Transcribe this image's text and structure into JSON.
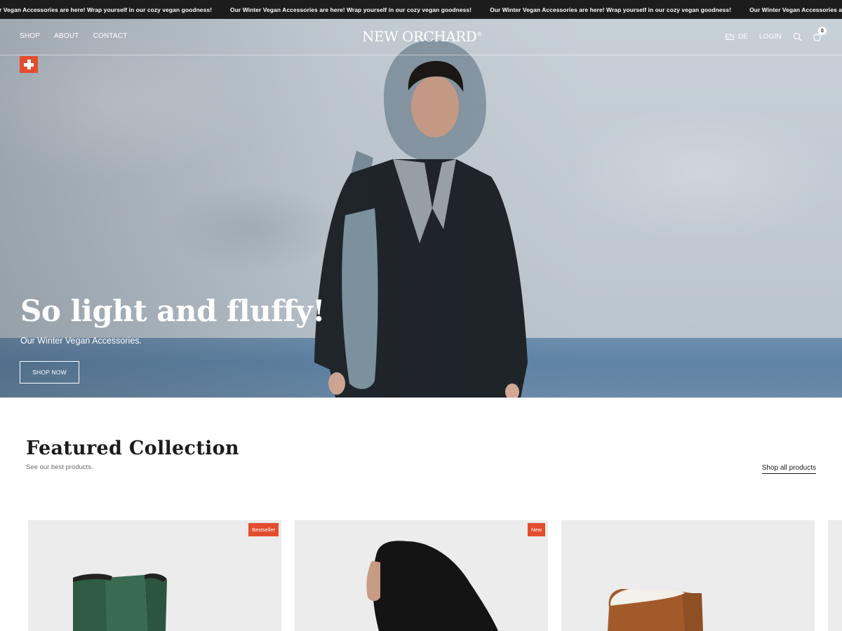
{
  "announcement": {
    "messages": [
      "Our Winter Vegan Accessories are here! Wrap yourself in our cozy vegan goodness!",
      "Our Winter Vegan Accessories are here! Wrap yourself in our cozy vegan goodness!",
      "Our Winter Vegan Accessories are here! Wrap yourself in our cozy vegan goodness!",
      "Our Winter Vegan Accessories are here! Wrap yourself in our cozy vegan goodness!"
    ]
  },
  "nav": {
    "left": [
      "SHOP",
      "ABOUT",
      "CONTACT"
    ],
    "logo": "NEW ORCHARD",
    "logo_mark": "®",
    "languages": [
      "EN",
      "DE"
    ],
    "active_language": "EN",
    "login": "LOGIN",
    "cart_count": "0",
    "icons": [
      "swiss-cross-icon",
      "search-icon",
      "cart-icon"
    ]
  },
  "hero": {
    "title": "So light and fluffy!",
    "subtitle": "Our Winter Vegan Accessories.",
    "cta": "SHOP NOW"
  },
  "featured": {
    "title": "Featured Collection",
    "subtitle": "See our best products.",
    "shop_all": "Shop all products",
    "products": [
      {
        "badge": "Bestseller",
        "image": "green-boot"
      },
      {
        "badge": "New",
        "image": "black-hood"
      },
      {
        "badge": "",
        "image": "brown-slipper"
      }
    ]
  },
  "colors": {
    "accent": "#e34d2f",
    "announcement_bg": "#1c1c1c",
    "card_bg": "#ececec"
  }
}
